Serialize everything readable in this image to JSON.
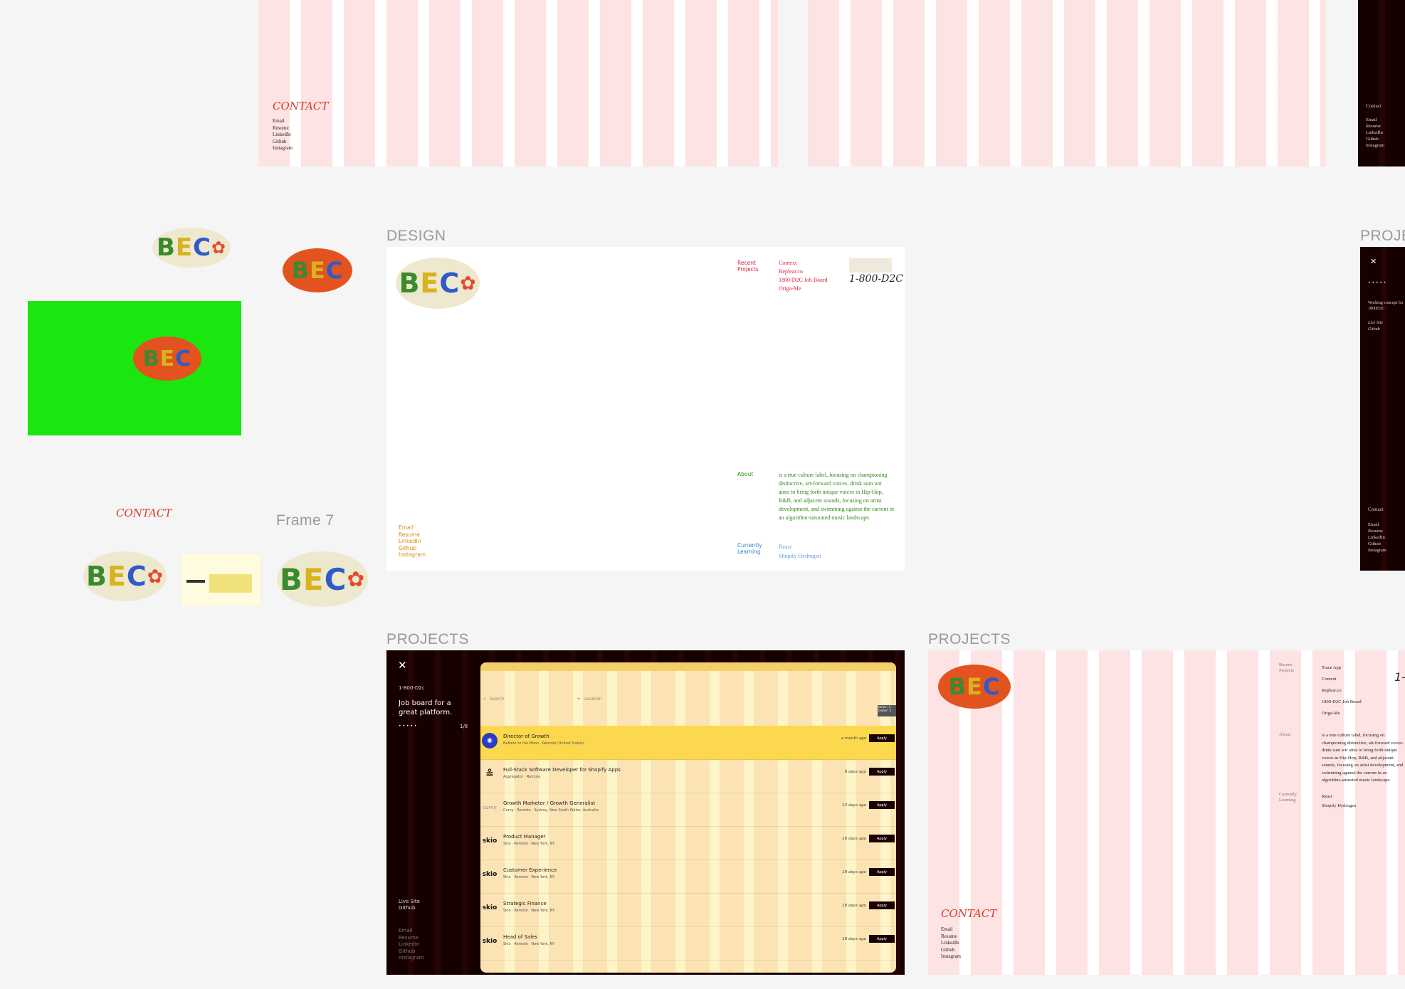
{
  "canvas_labels": {
    "design": "DESIGN",
    "projects_right": "PROJE",
    "frame7": "Frame 7",
    "projects_dark": "PROJECTS",
    "projects_pink": "PROJECTS"
  },
  "top_left_frame": {
    "contact_title": "CONTACT",
    "links": [
      "Email",
      "Resume",
      "LinkedIn",
      "Github",
      "Instagram"
    ]
  },
  "top_right_frame": {
    "contact_title": "Contact",
    "links": [
      "Email",
      "Resume",
      "LinkedIn",
      "Github",
      "Instagram"
    ]
  },
  "logo": {
    "b": "B",
    "e": "E",
    "c": "C",
    "flower": "✿"
  },
  "loose_contact": "CONTACT",
  "design_frame": {
    "recent_projects_label": "Recent Projects",
    "projects": [
      "Context",
      "Replear.co",
      "1800-D2C Job Board",
      "Origa-Me"
    ],
    "brand_mark": "1-800-D2C",
    "about_label": "About",
    "about_text": "is a true culture label, focusing on championing distinctive, art-forward voices. drink sum wtr aims to bring forth unique voices in Hip-Hop, R&B, and adjacent sounds, focusing on artist development, and swimming against the current in an algorithm-saturated music landscape.",
    "learning_label": "Currently Learning",
    "learning": [
      "React",
      "Shopify Hydrogen"
    ],
    "links": [
      "Email",
      "Resume",
      "LinkedIn",
      "Github",
      "Instagram"
    ]
  },
  "right_dark_frame": {
    "close": "✕",
    "dots": "• • • • •",
    "desc": "Working concept for 1800D2C",
    "live": "Live Site",
    "github": "Github",
    "contact": "Contact",
    "links": [
      "Email",
      "Resume",
      "LinkedIn",
      "Github",
      "Instagram"
    ]
  },
  "dark_project": {
    "close": "✕",
    "name": "1-800-D2c",
    "tagline": "Job board for a great platform.",
    "dots": "• • • • •",
    "counter": "1/8",
    "live": "Live Site",
    "github": "Github",
    "links": [
      "Email",
      "Resume",
      "LinkedIn",
      "Github",
      "Instagram"
    ],
    "search_placeholder": "Search",
    "location_placeholder": "Location",
    "tooltip": "Inner: 3\nOuter: 1",
    "jobs": [
      {
        "logo": "◉",
        "title": "Director of Growth",
        "company": "Balloon to the Moon",
        "loc": "Remote (United States)",
        "time": "a month ago",
        "apply": "Apply"
      },
      {
        "logo": "≗",
        "title": "Full-Stack Software Developer for Shopify Apps",
        "company": "Aggregator",
        "loc": "Remote",
        "time": "8 days ago",
        "apply": "Apply"
      },
      {
        "logo": "curvy",
        "title": "Growth Marketer / Growth Generalist",
        "company": "Curvy",
        "loc": "Remote · Sydney, New South Wales, Australia",
        "time": "13 days ago",
        "apply": "Apply"
      },
      {
        "logo": "skio",
        "title": "Product Manager",
        "company": "Skio",
        "loc": "Remote · New York, NY",
        "time": "18 days ago",
        "apply": "Apply"
      },
      {
        "logo": "skio",
        "title": "Customer Experience",
        "company": "Skio",
        "loc": "Remote · New York, NY",
        "time": "18 days ago",
        "apply": "Apply"
      },
      {
        "logo": "skio",
        "title": "Strategic Finance",
        "company": "Skio",
        "loc": "Remote · New York, NY",
        "time": "18 days ago",
        "apply": "Apply"
      },
      {
        "logo": "skio",
        "title": "Head of Sales",
        "company": "Skio",
        "loc": "Remote · New York, NY",
        "time": "18 days ago",
        "apply": "Apply"
      }
    ]
  },
  "pink_project": {
    "recent_label": "Recent Projects",
    "projects": [
      "Trace App",
      "Context",
      "Replear.co",
      "1800-D2C Job Board",
      "Origa-Me"
    ],
    "about_label": "About",
    "about_text": "is a true culture label, focusing on championing distinctive, art-forward voices. drink sum wtr aims to bring forth unique voices in Hip-Hop, R&B, and adjacent sounds, focusing on artist development, and swimming against the current in an algorithm-saturated music landscape.",
    "learning_label": "Currently Learning",
    "learning": [
      "React",
      "Shopify Hydrogen"
    ],
    "contact_title": "CONTACT",
    "links": [
      "Email",
      "Resume",
      "LinkedIn",
      "Github",
      "Instagram"
    ],
    "brand_fragment": "1-"
  },
  "colors": {
    "green_canvas": "#1be60f",
    "accent_red": "#d83a2a",
    "dark": "#170000",
    "stripe_pink": "#fde3e3"
  }
}
